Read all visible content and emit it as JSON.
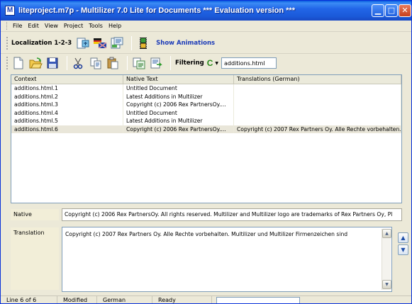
{
  "window": {
    "title": "liteproject.m7p - Multilizer 7.0 Lite for Documents *** Evaluation version ***",
    "app_icon_letter": "M",
    "minimize_glyph": "▁",
    "maximize_glyph": "□",
    "close_glyph": "✕"
  },
  "menu": {
    "items": [
      "File",
      "Edit",
      "View",
      "Project",
      "Tools",
      "Help"
    ]
  },
  "toolbar1": {
    "localization_label": "Localization 1-2-3",
    "show_animations_label": "Show Animations",
    "icons": [
      "scan-icon",
      "translate-icon",
      "build-icon",
      "film-icon"
    ]
  },
  "toolbar2": {
    "icons": [
      "new-file-icon",
      "open-folder-icon",
      "save-icon",
      "cut-icon",
      "copy-icon",
      "paste-icon",
      "properties-icon",
      "export-icon"
    ],
    "filtering_label": "Filtering",
    "filter_glyph": "C",
    "filter_value": "additions.html"
  },
  "grid": {
    "columns": [
      "Context",
      "Native Text",
      "Translations (German)"
    ],
    "rows": [
      {
        "context": "additions.html.1",
        "native": "Untitled Document",
        "translation": ""
      },
      {
        "context": "additions.html.2",
        "native": "Latest Additions in Multilizer",
        "translation": ""
      },
      {
        "context": "additions.html.3",
        "native": "Copyright (c) 2006 Rex PartnersOy....",
        "translation": ""
      },
      {
        "context": "additions.html.4",
        "native": "Untitled Document",
        "translation": ""
      },
      {
        "context": "additions.html.5",
        "native": "Latest Additions in Multilizer",
        "translation": ""
      },
      {
        "context": "additions.html.6",
        "native": "Copyright (c) 2006 Rex PartnersOy....",
        "translation": "Copyright (c) 2007 Rex Partners Oy. Alle Rechte vorbehalten..."
      }
    ],
    "selected_index": 5
  },
  "native": {
    "label": "Native",
    "text": "Copyright (c) 2006 Rex PartnersOy. All rights reserved. Multilizer and Multilizer logo are trademarks of Rex Partners Oy, Pl"
  },
  "translation": {
    "label": "Translation",
    "text": "Copyright (c) 2007 Rex Partners Oy. Alle Rechte vorbehalten. Multilizer und Multilizer Firmenzeichen sind"
  },
  "statusbar": {
    "line": "Line 6 of 6",
    "state": "Modified",
    "language": "German",
    "status": "Ready"
  },
  "colors": {
    "titlebar": "#2266e8",
    "accent_blue": "#1c3bb8",
    "filter_green": "#2a8a1a",
    "selected_row": "#e9e6d9"
  }
}
